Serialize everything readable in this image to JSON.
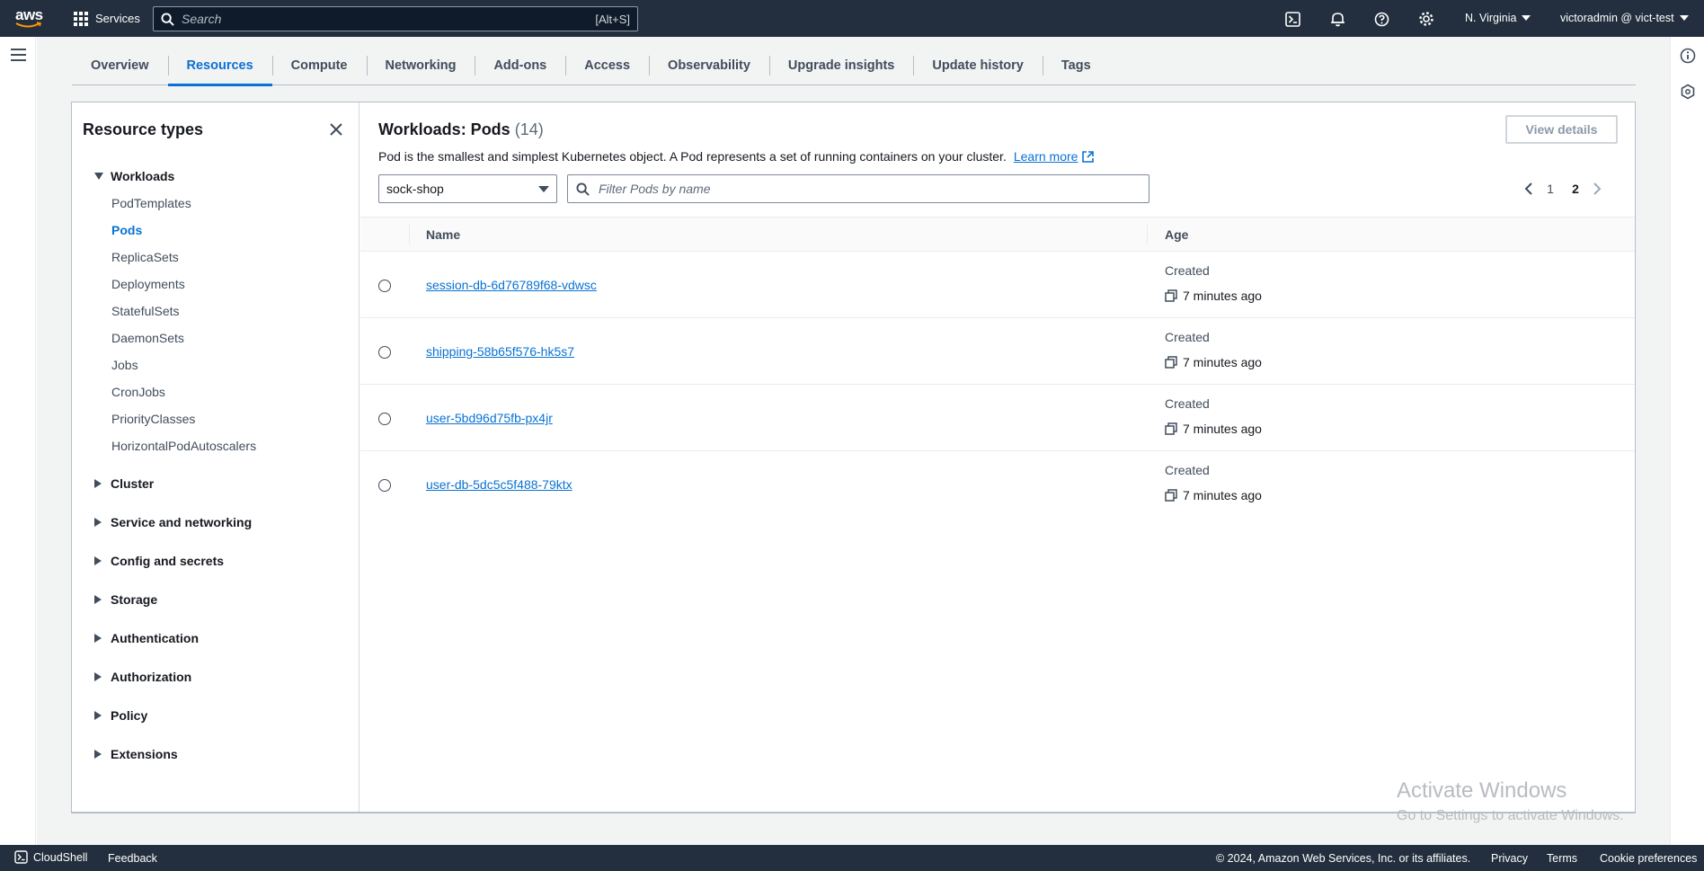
{
  "topnav": {
    "logo_text": "aws",
    "services_label": "Services",
    "search_placeholder": "Search",
    "search_shortcut": "[Alt+S]",
    "region": "N. Virginia",
    "account": "victoradmin @ vict-test",
    "icons": [
      "cloudshell-icon",
      "bell-icon",
      "help-icon",
      "gear-icon"
    ]
  },
  "tabs": [
    {
      "label": "Overview"
    },
    {
      "label": "Resources",
      "active": true
    },
    {
      "label": "Compute"
    },
    {
      "label": "Networking"
    },
    {
      "label": "Add-ons"
    },
    {
      "label": "Access"
    },
    {
      "label": "Observability"
    },
    {
      "label": "Upgrade insights"
    },
    {
      "label": "Update history"
    },
    {
      "label": "Tags"
    }
  ],
  "sidebar": {
    "title": "Resource types",
    "workloads": {
      "label": "Workloads",
      "items": [
        "PodTemplates",
        "Pods",
        "ReplicaSets",
        "Deployments",
        "StatefulSets",
        "DaemonSets",
        "Jobs",
        "CronJobs",
        "PriorityClasses",
        "HorizontalPodAutoscalers"
      ],
      "active": "Pods"
    },
    "groups": [
      "Cluster",
      "Service and networking",
      "Config and secrets",
      "Storage",
      "Authentication",
      "Authorization",
      "Policy",
      "Extensions"
    ]
  },
  "main": {
    "title": "Workloads: Pods",
    "count": "(14)",
    "view_details": "View details",
    "description": "Pod is the smallest and simplest Kubernetes object. A Pod represents a set of running containers on your cluster.",
    "learn_more": "Learn more",
    "namespace": "sock-shop",
    "filter_placeholder": "Filter Pods by name",
    "pages": [
      "1",
      "2"
    ],
    "current_page": "2",
    "columns": [
      "Name",
      "Age"
    ],
    "rows": [
      {
        "name": "session-db-6d76789f68-vdwsc",
        "created": "Created",
        "age": "7 minutes ago"
      },
      {
        "name": "shipping-58b65f576-hk5s7",
        "created": "Created",
        "age": "7 minutes ago"
      },
      {
        "name": "user-5bd96d75fb-px4jr",
        "created": "Created",
        "age": "7 minutes ago"
      },
      {
        "name": "user-db-5dc5c5f488-79ktx",
        "created": "Created",
        "age": "7 minutes ago"
      }
    ]
  },
  "watermark": {
    "line1": "Activate Windows",
    "line2": "Go to Settings to activate Windows."
  },
  "footer": {
    "cloudshell": "CloudShell",
    "feedback": "Feedback",
    "copyright": "© 2024, Amazon Web Services, Inc. or its affiliates.",
    "privacy": "Privacy",
    "terms": "Terms",
    "cookies": "Cookie preferences"
  },
  "colors": {
    "nav_bg": "#232f3e",
    "accent": "#0972d3",
    "content_bg": "#f2f3f3"
  }
}
